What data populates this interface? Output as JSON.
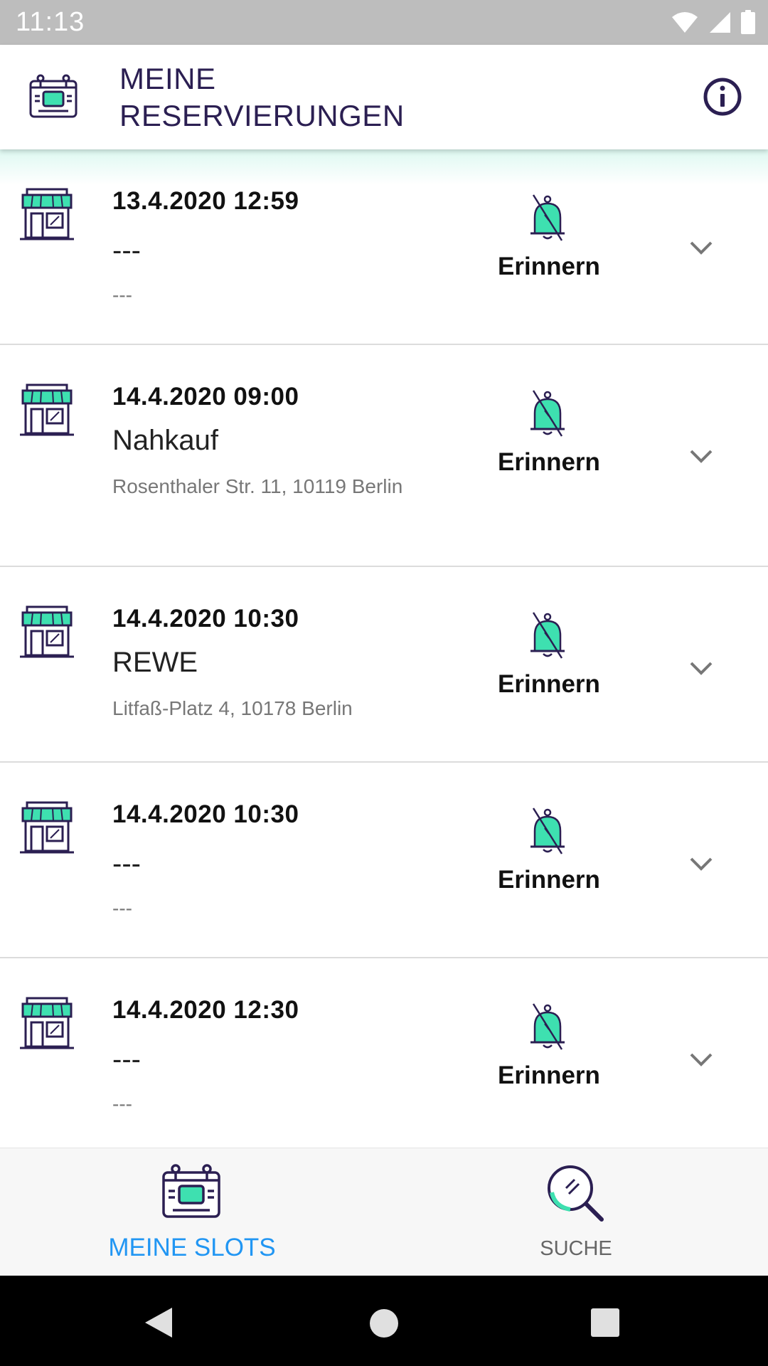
{
  "status_bar": {
    "time": "11:13",
    "icons": [
      "wifi-icon",
      "signal-icon",
      "battery-icon"
    ]
  },
  "app_bar": {
    "title_line1": "MEINE",
    "title_line2": "RESERVIERUNGEN",
    "info_icon": "info-icon"
  },
  "reservations": [
    {
      "date": "13.4.2020 12:59",
      "name": "---",
      "address": "---",
      "remind": "Erinnern"
    },
    {
      "date": "14.4.2020 09:00",
      "name": "Nahkauf",
      "address": "Rosenthaler Str. 11, 10119 Berlin",
      "remind": "Erinnern"
    },
    {
      "date": "14.4.2020 10:30",
      "name": "REWE",
      "address": "Litfaß-Platz 4, 10178 Berlin",
      "remind": "Erinnern"
    },
    {
      "date": "14.4.2020 10:30",
      "name": "---",
      "address": "---",
      "remind": "Erinnern"
    },
    {
      "date": "14.4.2020 12:30",
      "name": "---",
      "address": "---",
      "remind": "Erinnern"
    }
  ],
  "bottom_nav": {
    "tabs": [
      {
        "label": "MEINE SLOTS",
        "icon": "calendar-screen-icon",
        "active": true
      },
      {
        "label": "SUCHE",
        "icon": "magnifier-icon",
        "active": false
      }
    ]
  },
  "system_nav": {
    "buttons": [
      "back-icon",
      "home-icon",
      "recents-icon"
    ]
  },
  "colors": {
    "primary": "#2b1f52",
    "accent_teal": "#3ee0b0",
    "active_tab": "#2196f3",
    "status_bar": "#bdbdbd"
  }
}
